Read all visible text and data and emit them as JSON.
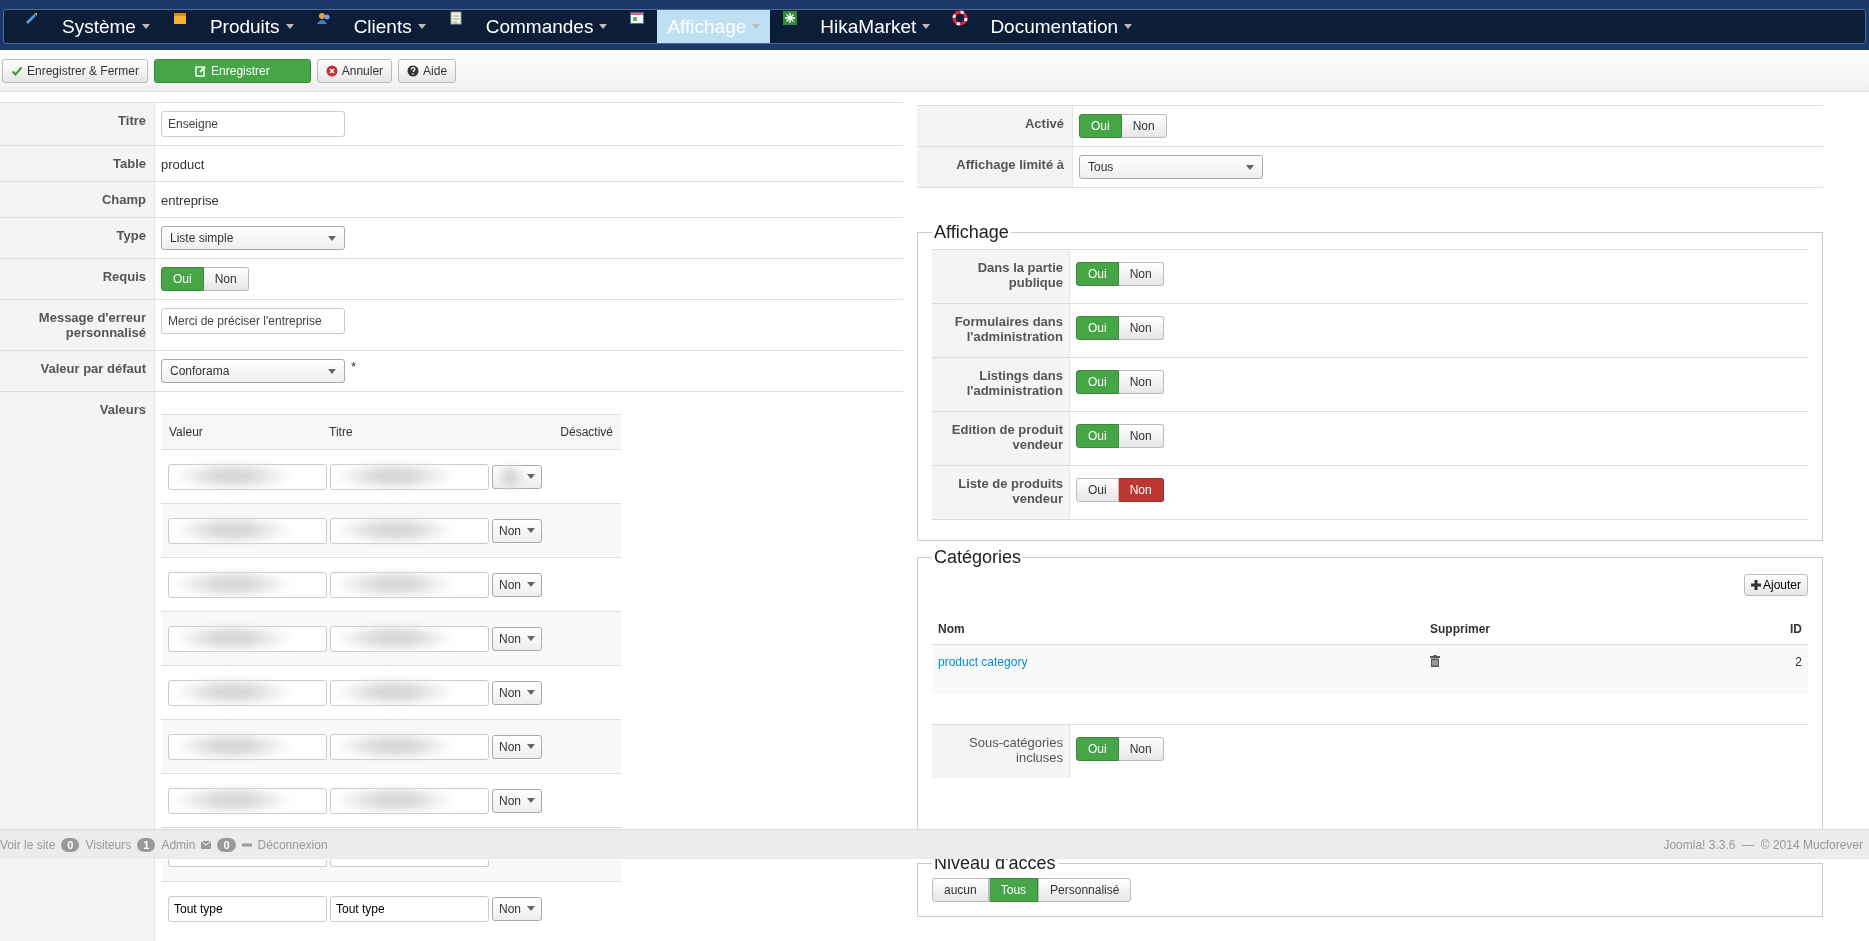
{
  "nav": [
    {
      "label": "Système",
      "selected": false
    },
    {
      "label": "Produits",
      "selected": false
    },
    {
      "label": "Clients",
      "selected": false
    },
    {
      "label": "Commandes",
      "selected": false
    },
    {
      "label": "Affichage",
      "selected": true
    },
    {
      "label": "HikaMarket",
      "selected": false
    },
    {
      "label": "Documentation",
      "selected": false
    }
  ],
  "toolbar": [
    {
      "label": "Enregistrer & Fermer",
      "kind": "save-close"
    },
    {
      "label": "Enregistrer",
      "kind": "save"
    },
    {
      "label": "Annuler",
      "kind": "cancel"
    },
    {
      "label": "Aide",
      "kind": "help"
    }
  ],
  "field_form": [
    {
      "label": "Titre",
      "kind": "input",
      "value": "Enseigne"
    },
    {
      "label": "Table",
      "kind": "text",
      "value": "product"
    },
    {
      "label": "Champ",
      "kind": "text",
      "value": "entreprise"
    },
    {
      "label": "Type",
      "kind": "select",
      "value": "Liste simple"
    },
    {
      "label": "Requis",
      "kind": "toggle",
      "options": [
        {
          "label": "Oui",
          "kind": "yes",
          "selected": true
        },
        {
          "label": "Non",
          "kind": "no",
          "selected": false
        }
      ]
    },
    {
      "label": "Message d'erreur personnalisé",
      "kind": "input",
      "value": "Merci de préciser l'entreprise"
    },
    {
      "label": "Valeur par défaut",
      "kind": "select",
      "value": "Conforama",
      "suffix": "*"
    }
  ],
  "values": {
    "label": "Valeurs",
    "columns": [
      "Valeur",
      "Titre",
      "Désactivé"
    ],
    "rows": [
      {
        "kind": "blurred"
      },
      {
        "kind": "blurred",
        "disabled": "Non"
      },
      {
        "kind": "blurred",
        "disabled": "Non"
      },
      {
        "kind": "blurred",
        "disabled": "Non"
      },
      {
        "kind": "blurred",
        "disabled": "Non"
      },
      {
        "kind": "blurred",
        "disabled": "Non"
      },
      {
        "kind": "blurred",
        "disabled": "Non"
      },
      {
        "kind": "covered"
      },
      {
        "kind": "text",
        "value": "Tout type",
        "title": "Tout type",
        "disabled": "Non"
      }
    ]
  },
  "settings": [
    {
      "label": "Activé",
      "kind": "toggle",
      "options": [
        {
          "label": "Oui",
          "kind": "yes",
          "selected": true
        },
        {
          "label": "Non",
          "kind": "no",
          "selected": false
        }
      ]
    },
    {
      "label": "Affichage limité à",
      "kind": "select",
      "value": "Tous"
    }
  ],
  "affichage": {
    "legend": "Affichage",
    "rows": [
      {
        "label": "Dans la partie publique",
        "options": [
          {
            "label": "Oui",
            "kind": "yes",
            "selected": true
          },
          {
            "label": "Non",
            "kind": "no",
            "selected": false
          }
        ]
      },
      {
        "label": "Formulaires dans l'administration",
        "options": [
          {
            "label": "Oui",
            "kind": "yes",
            "selected": true
          },
          {
            "label": "Non",
            "kind": "no",
            "selected": false
          }
        ]
      },
      {
        "label": "Listings dans l'administration",
        "options": [
          {
            "label": "Oui",
            "kind": "yes",
            "selected": true
          },
          {
            "label": "Non",
            "kind": "no",
            "selected": false
          }
        ]
      },
      {
        "label": "Edition de produit vendeur",
        "options": [
          {
            "label": "Oui",
            "kind": "yes",
            "selected": true
          },
          {
            "label": "Non",
            "kind": "no",
            "selected": false
          }
        ]
      },
      {
        "label": "Liste de produits vendeur",
        "options": [
          {
            "label": "Oui",
            "kind": "yes",
            "selected": false
          },
          {
            "label": "Non",
            "kind": "no",
            "selected": true
          }
        ]
      }
    ]
  },
  "categories": {
    "legend": "Catégories",
    "add_button": "Ajouter",
    "columns": [
      "Nom",
      "Supprimer",
      "ID"
    ],
    "rows": [
      {
        "name": "product category",
        "id": "2"
      }
    ],
    "subcategories": {
      "label": "Sous-catégories incluses",
      "options": [
        {
          "label": "Oui",
          "kind": "yes",
          "selected": true
        },
        {
          "label": "Non",
          "kind": "no",
          "selected": false
        }
      ]
    }
  },
  "access": {
    "legend": "Niveau d'accès",
    "options": [
      {
        "label": "aucun",
        "selected": false
      },
      {
        "label": "Tous",
        "selected": true
      },
      {
        "label": "Personnalisé",
        "selected": false
      }
    ]
  },
  "status_bar": {
    "view_site": "Voir le site",
    "visitors_count": "0",
    "visitors": "Visiteurs",
    "admin_count": "1",
    "admin": "Admin",
    "messages_count": "0",
    "logout": "Déconnexion",
    "version": "Joomla! 3.3.6  —  © 2014 Mucforever"
  }
}
